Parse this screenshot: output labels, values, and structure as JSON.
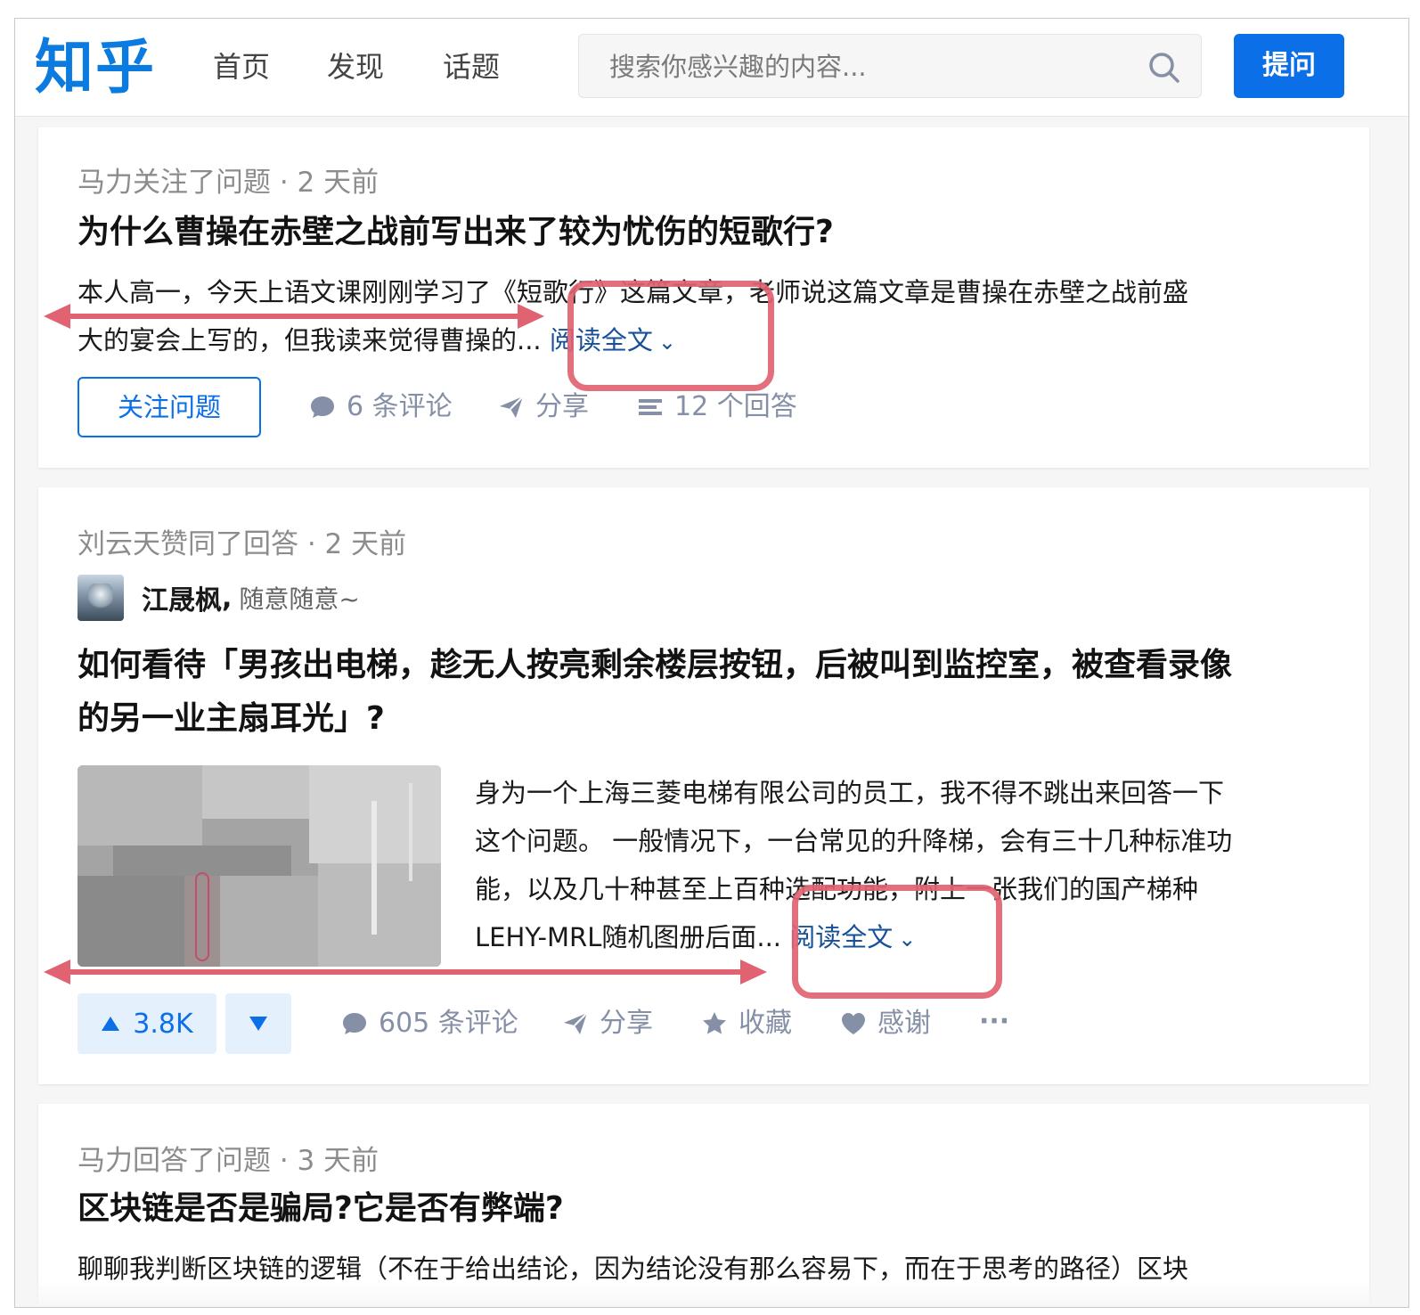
{
  "header": {
    "logo": "知乎",
    "nav": [
      "首页",
      "发现",
      "话题"
    ],
    "search_placeholder": "搜索你感兴趣的内容...",
    "ask_label": "提问"
  },
  "cards": [
    {
      "meta": "马力关注了问题 · 2 天前",
      "title": "为什么曹操在赤壁之战前写出来了较为忧伤的短歌行?",
      "excerpt_line1": "本人高一，今天上语文课刚刚学习了《短歌行》这篇文章，老师说这篇文章是曹操在赤壁之战前盛",
      "excerpt_line2": "大的宴会上写的，但我读来觉得曹操的...",
      "read_more": "阅读全文",
      "follow_label": "关注问题",
      "comments": "6 条评论",
      "share": "分享",
      "answers": "12 个回答"
    },
    {
      "meta": "刘云天赞同了回答 · 2 天前",
      "author_name": "江晟枫",
      "author_sep": ",",
      "author_bio": "随意随意~",
      "title_line1": "如何看待「男孩出电梯，趁无人按亮剩余楼层按钮，后被叫到监控室，被查看录像",
      "title_line2": "的另一业主扇耳光」?",
      "excerpt_line1": "身为一个上海三菱电梯有限公司的员工，我不得不跳出来回答一下",
      "excerpt_line2": "这个问题。 一般情况下，一台常见的升降梯，会有三十几种标准功",
      "excerpt_line3": "能，以及几十种甚至上百种选配功能，附上一张我们的国产梯种",
      "excerpt_line4": "LEHY-MRL随机图册后面...",
      "read_more": "阅读全文",
      "votes": "3.8K",
      "comments": "605 条评论",
      "share": "分享",
      "collect": "收藏",
      "thanks": "感谢",
      "more": "···"
    },
    {
      "meta": "马力回答了问题 · 3 天前",
      "title": "区块链是否是骗局?它是否有弊端?",
      "excerpt_line1": "聊聊我判断区块链的逻辑（不在于给出结论，因为结论没有那么容易下，而在于思考的路径）区块"
    }
  ],
  "colors": {
    "brand": "#0b6fe8",
    "link": "#175199",
    "meta": "#8c8c8c",
    "action": "#8590a6",
    "annotation": "#e16372"
  },
  "icons": [
    "search-icon",
    "comment-icon",
    "share-icon",
    "answers-icon",
    "upvote-icon",
    "downvote-icon",
    "star-icon",
    "heart-icon",
    "chevron-down-icon"
  ]
}
